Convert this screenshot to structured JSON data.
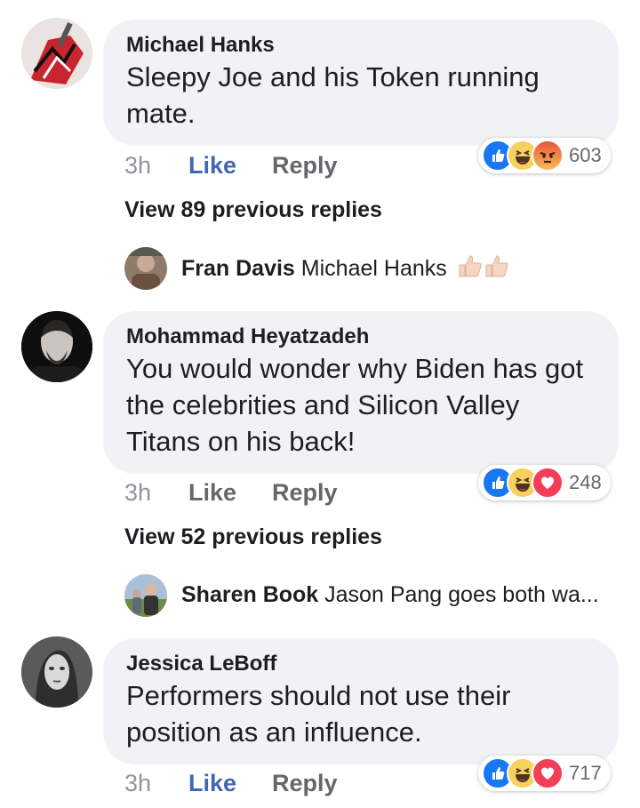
{
  "comments": [
    {
      "author": "Michael Hanks",
      "text_lines": [
        "Sleepy Joe and his Token running",
        "mate."
      ],
      "time": "3h",
      "like_label": "Like",
      "like_active": true,
      "reply_label": "Reply",
      "reactions": [
        "like-icon",
        "haha-icon",
        "angry-icon"
      ],
      "reaction_count": "603",
      "view_previous": "View 89 previous replies",
      "latest_reply": {
        "author": "Fran Davis",
        "text": "Michael Hanks",
        "emoji": "thumbs-up-icon"
      }
    },
    {
      "author": "Mohammad Heyatzadeh",
      "text_lines": [
        "You would wonder why Biden has got",
        "the celebrities and Silicon Valley",
        "Titans on his back!"
      ],
      "time": "3h",
      "like_label": "Like",
      "like_active": false,
      "reply_label": "Reply",
      "reactions": [
        "like-icon",
        "haha-icon",
        "love-icon"
      ],
      "reaction_count": "248",
      "view_previous": "View 52 previous replies",
      "latest_reply": {
        "author": "Sharen Book",
        "text": "Jason Pang goes both wa..."
      }
    },
    {
      "author": "Jessica LeBoff",
      "text_lines": [
        "Performers should not use their",
        "position as an influence."
      ],
      "time": "3h",
      "like_label": "Like",
      "like_active": true,
      "reply_label": "Reply",
      "reactions": [
        "like-icon",
        "haha-icon",
        "love-icon"
      ],
      "reaction_count": "717"
    }
  ],
  "colors": {
    "bubble": "#f0f2f5",
    "like_active": "#4267b2",
    "muted": "#65676b",
    "time": "#90949c",
    "like_reaction": "#1877f2",
    "haha_reaction": "#f7d15d",
    "love_reaction": "#f33e58",
    "angry_reaction": "#f06a3e"
  }
}
